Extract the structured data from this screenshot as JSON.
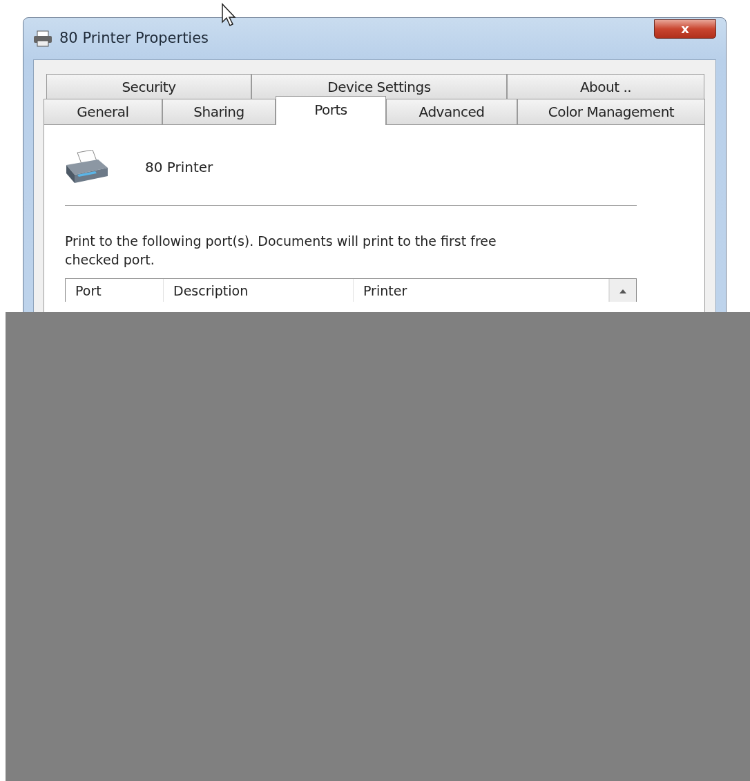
{
  "window": {
    "title": "80 Printer Properties",
    "close_label": "x"
  },
  "tab_rows": [
    [
      {
        "label": "Security",
        "selected": false
      },
      {
        "label": "Device Settings",
        "selected": false
      },
      {
        "label": "About ..",
        "selected": false
      }
    ],
    [
      {
        "label": "General",
        "selected": false
      },
      {
        "label": "Sharing",
        "selected": false
      },
      {
        "label": "Ports",
        "selected": true
      },
      {
        "label": "Advanced",
        "selected": false
      },
      {
        "label": "Color Management",
        "selected": false
      }
    ]
  ],
  "printer_name": "80 Printer",
  "instructions": "Print to the following port(s). Documents will print to the first free checked port.",
  "table": {
    "columns": [
      "Port",
      "Description",
      "Printer"
    ]
  }
}
